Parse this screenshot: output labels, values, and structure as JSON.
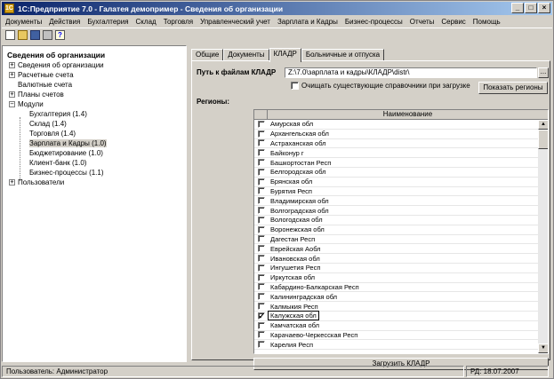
{
  "window": {
    "title": "1С:Предприятие 7.0 - Галатея демопример - Сведения об организации",
    "icon_text": "1С",
    "controls": [
      "_",
      "□",
      "×"
    ]
  },
  "menu": [
    "Документы",
    "Действия",
    "Бухгалтерия",
    "Склад",
    "Торговля",
    "Управленческий учет",
    "Зарплата и Кадры",
    "Бизнес-процессы",
    "Отчеты",
    "Сервис",
    "Помощь"
  ],
  "toolbar": [
    "new-document-icon",
    "open-icon",
    "save-icon",
    "print-icon",
    "help-icon"
  ],
  "left_panel": {
    "title": "Сведения об организации",
    "tree": [
      {
        "label": "Сведения об организации",
        "level": 1,
        "toggle": "+"
      },
      {
        "label": "Расчетные счета",
        "level": 1,
        "toggle": "+"
      },
      {
        "label": "Валютные счета",
        "level": 1,
        "toggle": ""
      },
      {
        "label": "Планы счетов",
        "level": 1,
        "toggle": "+"
      },
      {
        "label": "Модули",
        "level": 1,
        "toggle": "−"
      },
      {
        "label": "Бухгалтерия (1.4)",
        "level": 2,
        "toggle": ""
      },
      {
        "label": "Склад (1.4)",
        "level": 2,
        "toggle": ""
      },
      {
        "label": "Торговля (1.4)",
        "level": 2,
        "toggle": ""
      },
      {
        "label": "Зарплата и Кадры (1.0)",
        "level": 2,
        "toggle": "",
        "selected": true
      },
      {
        "label": "Бюджетирование (1.0)",
        "level": 2,
        "toggle": ""
      },
      {
        "label": "Клиент-банк (1.0)",
        "level": 2,
        "toggle": ""
      },
      {
        "label": "Бизнес-процессы (1.1)",
        "level": 2,
        "toggle": ""
      },
      {
        "label": "Пользователи",
        "level": 1,
        "toggle": "+"
      }
    ]
  },
  "tabs": [
    {
      "label": "Общие",
      "active": false
    },
    {
      "label": "Документы",
      "active": false
    },
    {
      "label": "КЛАДР",
      "active": true
    },
    {
      "label": "Больничные и отпуска",
      "active": false
    }
  ],
  "kladr": {
    "path_label": "Путь к файлам КЛАДР",
    "path_value": "Z:\\7.0\\зарплата и кадры\\КЛАДР\\distr\\",
    "browse_label": "...",
    "clear_label": "Очищать существующие справочники при загрузке",
    "clear_checked": false,
    "show_regions_label": "Показать регионы",
    "regions_label": "Регионы:",
    "column_header": "Наименование",
    "regions": [
      {
        "name": "Амурская обл",
        "checked": false
      },
      {
        "name": "Архангельская обл",
        "checked": false
      },
      {
        "name": "Астраханская обл",
        "checked": false
      },
      {
        "name": "Байконур г",
        "checked": false
      },
      {
        "name": "Башкортостан Респ",
        "checked": false
      },
      {
        "name": "Белгородская обл",
        "checked": false
      },
      {
        "name": "Брянская обл",
        "checked": false
      },
      {
        "name": "Бурятия Респ",
        "checked": false
      },
      {
        "name": "Владимирская обл",
        "checked": false
      },
      {
        "name": "Волгоградская обл",
        "checked": false
      },
      {
        "name": "Вологодская обл",
        "checked": false
      },
      {
        "name": "Воронежская обл",
        "checked": false
      },
      {
        "name": "Дагестан Респ",
        "checked": false
      },
      {
        "name": "Еврейская Аобл",
        "checked": false
      },
      {
        "name": "Ивановская обл",
        "checked": false
      },
      {
        "name": "Ингушетия Респ",
        "checked": false
      },
      {
        "name": "Иркутская обл",
        "checked": false
      },
      {
        "name": "Кабардино-Балкарская Респ",
        "checked": false
      },
      {
        "name": "Калининградская обл",
        "checked": false
      },
      {
        "name": "Калмыкия Респ",
        "checked": false
      },
      {
        "name": "Калужская обл",
        "checked": true,
        "selected": true
      },
      {
        "name": "Камчатская обл",
        "checked": false
      },
      {
        "name": "Карачаево-Черкесская Респ",
        "checked": false
      },
      {
        "name": "Карелия Респ",
        "checked": false
      }
    ],
    "load_label": "Загрузить КЛАДР",
    "scroll_up": "▲",
    "scroll_down": "▼",
    "check_mark": "✓"
  },
  "status": {
    "user": "Пользователь: Администратор",
    "date": "РД: 18.07.2007"
  }
}
